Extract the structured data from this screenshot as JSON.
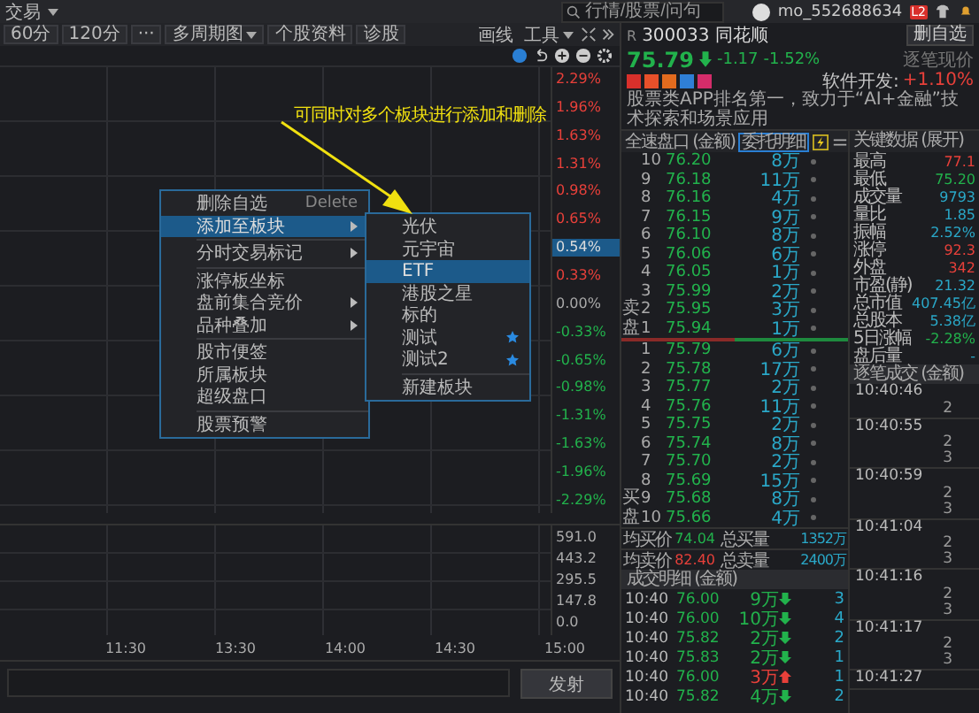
{
  "top_bar": {
    "menu": "交易",
    "search": {
      "placeholder": "行情/股票/问句"
    },
    "user": "mo_552688634",
    "badge": "L2"
  },
  "toolbar": {
    "buttons": [
      {
        "label": "60分",
        "dropdown": false
      },
      {
        "label": "120分",
        "dropdown": false
      },
      {
        "label": "···",
        "dropdown": false
      },
      {
        "label": "多周期图",
        "dropdown": true
      },
      {
        "label": "个股资料",
        "dropdown": false
      },
      {
        "label": "诊股",
        "dropdown": false
      }
    ],
    "right": [
      {
        "label": "画线",
        "dropdown": false
      },
      {
        "label": "工具",
        "dropdown": true
      }
    ]
  },
  "chart": {
    "price_axis": [
      {
        "label": "2.29%",
        "kind": "up"
      },
      {
        "label": "1.96%",
        "kind": "up"
      },
      {
        "label": "1.63%",
        "kind": "up"
      },
      {
        "label": "1.31%",
        "kind": "up"
      },
      {
        "label": "0.98%",
        "kind": "up"
      },
      {
        "label": "0.65%",
        "kind": "up"
      },
      {
        "label": "0.54%",
        "kind": "current"
      },
      {
        "label": "0.33%",
        "kind": "up"
      },
      {
        "label": "0.00%",
        "kind": "flat"
      },
      {
        "label": "-0.33%",
        "kind": "down"
      },
      {
        "label": "-0.65%",
        "kind": "down"
      },
      {
        "label": "-0.98%",
        "kind": "down"
      },
      {
        "label": "-1.31%",
        "kind": "down"
      },
      {
        "label": "-1.63%",
        "kind": "down"
      },
      {
        "label": "-1.96%",
        "kind": "down"
      },
      {
        "label": "-2.29%",
        "kind": "down"
      }
    ],
    "volume_axis": [
      "591.0",
      "443.2",
      "295.5",
      "147.8",
      "0.0"
    ],
    "time_axis": [
      "11:30",
      "13:30",
      "14:00",
      "14:30",
      "15:00"
    ]
  },
  "send": {
    "button": "发射"
  },
  "annotation": {
    "text": "可同时对多个板块进行添加和删除"
  },
  "context_menu": {
    "items": [
      {
        "kind": "item",
        "label": "删除自选",
        "shortcut": "Delete",
        "submenu": false,
        "selected": false
      },
      {
        "kind": "item",
        "label": "添加至板块",
        "submenu": true,
        "selected": true
      },
      {
        "kind": "divider"
      },
      {
        "kind": "item",
        "label": "分时交易标记",
        "submenu": true,
        "selected": false
      },
      {
        "kind": "divider"
      },
      {
        "kind": "item",
        "label": "涨停板坐标",
        "submenu": false,
        "selected": false
      },
      {
        "kind": "item",
        "label": "盘前集合竞价",
        "submenu": true,
        "selected": false
      },
      {
        "kind": "item",
        "label": "品种叠加",
        "submenu": true,
        "selected": false
      },
      {
        "kind": "divider"
      },
      {
        "kind": "item",
        "label": "股市便签",
        "submenu": false,
        "selected": false
      },
      {
        "kind": "item",
        "label": "所属板块",
        "submenu": false,
        "selected": false
      },
      {
        "kind": "item",
        "label": "超级盘口",
        "submenu": false,
        "selected": false
      },
      {
        "kind": "divider"
      },
      {
        "kind": "item",
        "label": "股票预警",
        "submenu": false,
        "selected": false
      }
    ]
  },
  "submenu": {
    "items": [
      {
        "kind": "item",
        "label": "光伏",
        "selected": false,
        "starred": false
      },
      {
        "kind": "item",
        "label": "元宇宙",
        "selected": false,
        "starred": false
      },
      {
        "kind": "item",
        "label": "ETF",
        "selected": true,
        "starred": false
      },
      {
        "kind": "item",
        "label": "港股之星",
        "selected": false,
        "starred": false
      },
      {
        "kind": "item",
        "label": "标的",
        "selected": false,
        "starred": false
      },
      {
        "kind": "item",
        "label": "测试",
        "selected": false,
        "starred": true
      },
      {
        "kind": "item",
        "label": "测试2",
        "selected": false,
        "starred": true
      },
      {
        "kind": "divider"
      },
      {
        "kind": "item",
        "label": "新建板块",
        "selected": false,
        "starred": false
      }
    ]
  },
  "stock": {
    "market": "R",
    "code": "300033",
    "name": "同花顺",
    "watch_button": "删自选",
    "price": "75.79",
    "rising": false,
    "change": "-1.17",
    "change_pct": "-1.52%",
    "price_mode": "逐笔现价",
    "tags": [
      {
        "color": "#d8302b"
      },
      {
        "color": "#e8502a"
      },
      {
        "color": "#e36b1e"
      },
      {
        "color": "#2f7fd6"
      },
      {
        "color": "#d42c6a"
      }
    ],
    "sector": "软件开发:",
    "sector_change": "+1.10%",
    "description": "股票类APP排名第一，致力于“AI+金融”技术探索和场景应用"
  },
  "order_book": {
    "title": "全速盘口 (金额)",
    "detail_button": "委托明细",
    "sell_label": "卖盘",
    "buy_label": "买盘",
    "sell": [
      {
        "level": "10",
        "price": "76.20",
        "volume": "8万"
      },
      {
        "level": "9",
        "price": "76.18",
        "volume": "11万"
      },
      {
        "level": "8",
        "price": "76.16",
        "volume": "4万"
      },
      {
        "level": "7",
        "price": "76.15",
        "volume": "9万"
      },
      {
        "level": "6",
        "price": "76.10",
        "volume": "8万"
      },
      {
        "level": "5",
        "price": "76.06",
        "volume": "6万"
      },
      {
        "level": "4",
        "price": "76.05",
        "volume": "1万"
      },
      {
        "level": "3",
        "price": "75.99",
        "volume": "2万"
      },
      {
        "level": "2",
        "price": "75.95",
        "volume": "3万"
      },
      {
        "level": "1",
        "price": "75.94",
        "volume": "1万"
      }
    ],
    "buy": [
      {
        "level": "1",
        "price": "75.79",
        "volume": "6万"
      },
      {
        "level": "2",
        "price": "75.78",
        "volume": "17万"
      },
      {
        "level": "3",
        "price": "75.77",
        "volume": "2万"
      },
      {
        "level": "4",
        "price": "75.76",
        "volume": "11万"
      },
      {
        "level": "5",
        "price": "75.75",
        "volume": "2万"
      },
      {
        "level": "6",
        "price": "75.74",
        "volume": "8万"
      },
      {
        "level": "7",
        "price": "75.70",
        "volume": "2万"
      },
      {
        "level": "8",
        "price": "75.69",
        "volume": "15万"
      },
      {
        "level": "9",
        "price": "75.68",
        "volume": "8万"
      },
      {
        "level": "10",
        "price": "75.66",
        "volume": "4万"
      }
    ],
    "summary": [
      {
        "label": "均买价",
        "price": "74.04",
        "color": "#22b24c",
        "total_label": "总买量",
        "total": "1352万"
      },
      {
        "label": "均卖价",
        "price": "82.40",
        "color": "#e8403a",
        "total_label": "总卖量",
        "total": "2400万"
      }
    ]
  },
  "trades": {
    "title": "成交明细 (金额)",
    "rows": [
      {
        "time": "10:40",
        "price": "76.00",
        "volume": "9万",
        "rising": false,
        "count": "3"
      },
      {
        "time": "10:40",
        "price": "76.00",
        "volume": "10万",
        "rising": false,
        "count": "4"
      },
      {
        "time": "10:40",
        "price": "75.82",
        "volume": "2万",
        "rising": false,
        "count": "2"
      },
      {
        "time": "10:40",
        "price": "75.83",
        "volume": "2万",
        "rising": false,
        "count": "1"
      },
      {
        "time": "10:40",
        "price": "76.00",
        "volume": "3万",
        "rising": true,
        "count": "1"
      },
      {
        "time": "10:40",
        "price": "75.82",
        "volume": "4万",
        "rising": false,
        "count": "2"
      }
    ]
  },
  "key_data": {
    "title": "关键数据 (展开)",
    "rows": [
      {
        "label": "最高",
        "value": "77.1",
        "color": "#e8403a"
      },
      {
        "label": "最低",
        "value": "75.20",
        "color": "#22b24c"
      },
      {
        "label": "成交量",
        "value": "9793",
        "color": "#2aa8c8"
      },
      {
        "label": "量比",
        "value": "1.85",
        "color": "#2aa8c8"
      },
      {
        "label": "振幅",
        "value": "2.52%",
        "color": "#2aa8c8"
      },
      {
        "label": "涨停",
        "value": "92.3",
        "color": "#e8403a"
      },
      {
        "label": "外盘",
        "value": "342",
        "color": "#e8403a"
      },
      {
        "label": "市盈(静)",
        "value": "21.32",
        "color": "#2aa8c8"
      },
      {
        "label": "总市值",
        "value": "407.45亿",
        "color": "#2aa8c8"
      },
      {
        "label": "总股本",
        "value": "5.38亿",
        "color": "#2aa8c8"
      },
      {
        "label": "5日涨幅",
        "value": "-2.28%",
        "color": "#22b24c"
      },
      {
        "label": "盘后量",
        "value": "-",
        "color": "#2aa8c8"
      }
    ]
  },
  "tick_trades": {
    "title": "逐笔成交 (金额)",
    "groups": [
      {
        "time": "10:40:46",
        "counts": [
          "2"
        ]
      },
      {
        "time": "10:40:55",
        "counts": [
          "2",
          "3"
        ]
      },
      {
        "time": "10:40:59",
        "counts": [
          "2",
          "3"
        ]
      },
      {
        "time": "10:41:04",
        "counts": [
          "2",
          "3"
        ]
      },
      {
        "time": "10:41:16",
        "counts": [
          "2",
          "3"
        ]
      },
      {
        "time": "10:41:17",
        "counts": [
          "2",
          "3"
        ]
      },
      {
        "time": "10:41:27"
      }
    ]
  }
}
